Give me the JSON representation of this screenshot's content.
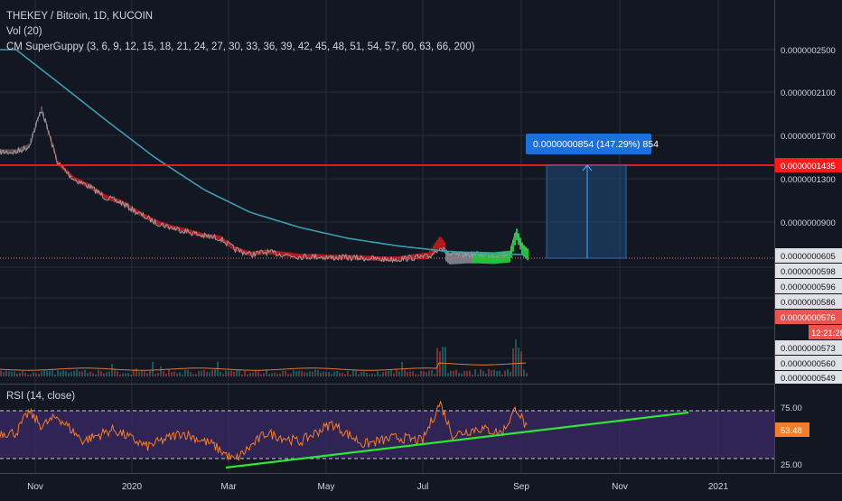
{
  "header": {
    "title": "THEKEY / Bitcoin, 1D, KUCOIN",
    "vol_label": "Vol (20)",
    "indicator_label": "CM SuperGuppy (3, 6, 9, 12, 15, 18, 21, 24, 27, 30, 33, 36, 39, 42, 45, 48, 51, 54, 57, 60, 63, 66, 200)"
  },
  "rsi": {
    "label": "RSI (14, close)",
    "current_value": "53.48",
    "upper_band": 70,
    "lower_band": 30
  },
  "price_axis": {
    "ticks": [
      "0.0000002500",
      "0.0000002100",
      "0.0000001700",
      "0.0000001300",
      "0.0000000900",
      "0.0000000605",
      "0.0000000598",
      "0.0000000596",
      "0.0000000586",
      "0.0000000573",
      "0.0000000560",
      "0.0000000549"
    ],
    "highlight_line": "0.0000001435",
    "last_price": "0.0000000576",
    "countdown": "12:21:28"
  },
  "rsi_axis": {
    "ticks": [
      "75.00",
      "25.00"
    ]
  },
  "time_axis": [
    "Nov",
    "2020",
    "Mar",
    "May",
    "Jul",
    "Sep",
    "Nov",
    "2021"
  ],
  "projection": {
    "label": "0.0000000854 (147.29%) 854"
  },
  "colors": {
    "background": "#131722",
    "resistance": "#ff1b1b",
    "ema200": "#3d9bb3",
    "bear_ribbon": "#d81c1c",
    "bull_ribbon": "#22e23c",
    "rsi_line": "#f57c2a",
    "rsi_band": "#3b2a66",
    "trendline": "#2ee634",
    "projection_box": "#1f4a7a",
    "projection_label": "#1d6fd9"
  },
  "chart_data": [
    {
      "type": "line",
      "title": "THEKEY / Bitcoin, 1D, KUCOIN",
      "ylim": [
        5.4e-08,
        2.7e-07
      ],
      "series": [
        {
          "name": "price",
          "x": [
            "2019-10-20",
            "2019-10-28",
            "2019-11-05",
            "2019-11-15",
            "2019-11-25",
            "2019-12-05",
            "2019-12-15",
            "2019-12-25",
            "2020-01-05",
            "2020-01-15",
            "2020-01-25",
            "2020-02-05",
            "2020-02-15",
            "2020-02-25",
            "2020-03-05",
            "2020-03-15",
            "2020-03-25",
            "2020-04-05",
            "2020-04-15",
            "2020-04-25",
            "2020-05-05",
            "2020-05-15",
            "2020-05-25",
            "2020-06-05",
            "2020-06-15",
            "2020-06-25",
            "2020-07-05",
            "2020-07-12",
            "2020-07-18",
            "2020-07-28",
            "2020-08-05",
            "2020-08-15",
            "2020-08-25",
            "2020-08-29",
            "2020-09-02",
            "2020-09-05"
          ],
          "y": [
            1.55e-07,
            1.6e-07,
            1.95e-07,
            1.45e-07,
            1.3e-07,
            1.23e-07,
            1.13e-07,
            1.08e-07,
            9.8e-08,
            9e-08,
            8.5e-08,
            8.1e-08,
            7.7e-08,
            7.5e-08,
            6.5e-08,
            6e-08,
            6.2e-08,
            6e-08,
            5.8e-08,
            5.8e-08,
            5.7e-08,
            5.7e-08,
            5.65e-08,
            5.55e-08,
            5.55e-08,
            5.7e-08,
            5.75e-08,
            6.7e-08,
            5.9e-08,
            6e-08,
            6e-08,
            5.95e-08,
            6.1e-08,
            8.2e-08,
            6.7e-08,
            6.3e-08
          ]
        },
        {
          "name": "EMA 200",
          "x": [
            "2019-10-20",
            "2019-11-15",
            "2019-12-15",
            "2020-01-15",
            "2020-02-15",
            "2020-03-15",
            "2020-04-15",
            "2020-05-15",
            "2020-06-15",
            "2020-07-15",
            "2020-08-15",
            "2020-09-05"
          ],
          "y": [
            2.5e-07,
            2.2e-07,
            1.85e-07,
            1.5e-07,
            1.2e-07,
            9.9e-08,
            8.5e-08,
            7.5e-08,
            6.8e-08,
            6.3e-08,
            6.05e-08,
            5.98e-08
          ]
        }
      ],
      "annotations": {
        "resistance": 1.435e-07,
        "projection_target": 8.54e-08,
        "projection_change_pct": 147.29
      }
    },
    {
      "type": "line",
      "title": "RSI (14, close)",
      "ylim": [
        20,
        80
      ],
      "series": [
        {
          "name": "RSI",
          "x": [
            "2019-10-20",
            "2019-10-28",
            "2019-11-05",
            "2019-11-15",
            "2019-12-01",
            "2019-12-20",
            "2020-01-10",
            "2020-02-01",
            "2020-02-20",
            "2020-03-05",
            "2020-03-25",
            "2020-04-15",
            "2020-05-05",
            "2020-05-25",
            "2020-06-15",
            "2020-07-01",
            "2020-07-12",
            "2020-07-20",
            "2020-08-05",
            "2020-08-20",
            "2020-08-29",
            "2020-09-05"
          ],
          "y": [
            52,
            70,
            58,
            66,
            45,
            55,
            40,
            52,
            42,
            28,
            52,
            44,
            60,
            42,
            48,
            45,
            78,
            50,
            56,
            52,
            74,
            54
          ]
        }
      ]
    }
  ]
}
